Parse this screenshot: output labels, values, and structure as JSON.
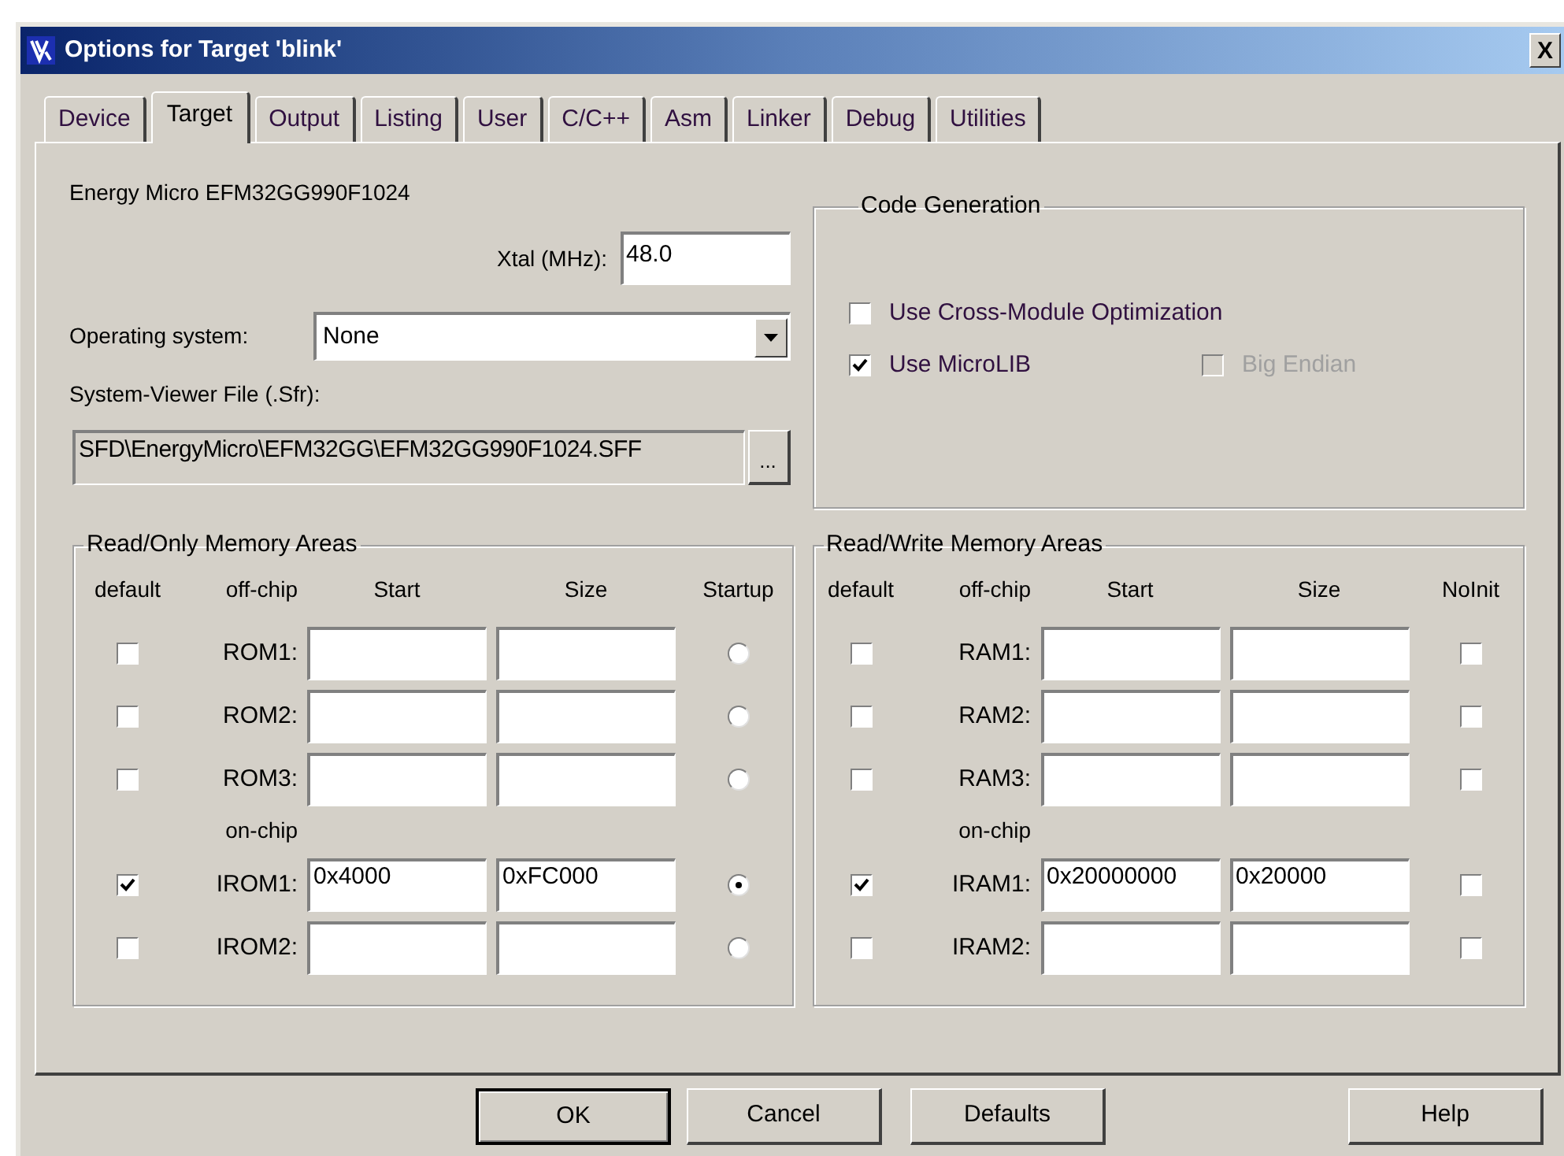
{
  "window": {
    "title": "Options for Target 'blink'",
    "close_button": "X"
  },
  "tabs": [
    {
      "label": "Device",
      "selected": false
    },
    {
      "label": "Target",
      "selected": true
    },
    {
      "label": "Output",
      "selected": false
    },
    {
      "label": "Listing",
      "selected": false
    },
    {
      "label": "User",
      "selected": false
    },
    {
      "label": "C/C++",
      "selected": false
    },
    {
      "label": "Asm",
      "selected": false
    },
    {
      "label": "Linker",
      "selected": false
    },
    {
      "label": "Debug",
      "selected": false
    },
    {
      "label": "Utilities",
      "selected": false
    }
  ],
  "device": "Energy Micro EFM32GG990F1024",
  "xtal": {
    "label": "Xtal (MHz):",
    "value": "48.0"
  },
  "operating_system": {
    "label": "Operating system:",
    "value": "None"
  },
  "system_viewer_file": {
    "label": "System-Viewer File (.Sfr):",
    "value": "SFD\\EnergyMicro\\EFM32GG\\EFM32GG990F1024.SFF",
    "browse_button": "..."
  },
  "code_generation": {
    "title": "Code Generation",
    "options": [
      {
        "label": "Use Cross-Module Optimization",
        "checked": false,
        "disabled": false
      },
      {
        "label": "Use MicroLIB",
        "checked": true,
        "disabled": false
      },
      {
        "label": "Big Endian",
        "checked": false,
        "disabled": true
      }
    ]
  },
  "memory_areas": [
    {
      "title": "Read/Only Memory Areas",
      "columns": [
        "default",
        "off-chip",
        "Start",
        "Size",
        "Startup"
      ],
      "rows": [
        {
          "kind": "entry",
          "default_checked": false,
          "label": "ROM1:",
          "startup_selected": false
        },
        {
          "kind": "entry",
          "default_checked": false,
          "label": "ROM2:",
          "startup_selected": false
        },
        {
          "kind": "entry",
          "default_checked": false,
          "label": "ROM3:",
          "startup_selected": false
        },
        {
          "kind": "section",
          "label": "on-chip"
        },
        {
          "kind": "entry",
          "default_checked": true,
          "label": "IROM1:",
          "start": "0x4000",
          "size": "0xFC000",
          "startup_selected": true
        },
        {
          "kind": "entry",
          "default_checked": false,
          "label": "IROM2:",
          "startup_selected": false
        }
      ]
    },
    {
      "title": "Read/Write Memory Areas",
      "columns": [
        "default",
        "off-chip",
        "Start",
        "Size",
        "NoInit"
      ],
      "rows": [
        {
          "kind": "entry",
          "default_checked": false,
          "label": "RAM1:",
          "noinit_checked": false
        },
        {
          "kind": "entry",
          "default_checked": false,
          "label": "RAM2:",
          "noinit_checked": false
        },
        {
          "kind": "entry",
          "default_checked": false,
          "label": "RAM3:",
          "noinit_checked": false
        },
        {
          "kind": "section",
          "label": "on-chip"
        },
        {
          "kind": "entry",
          "default_checked": true,
          "label": "IRAM1:",
          "start": "0x20000000",
          "size": "0x20000",
          "noinit_checked": false
        },
        {
          "kind": "entry",
          "default_checked": false,
          "label": "IRAM2:",
          "noinit_checked": false
        }
      ]
    }
  ],
  "buttons": [
    {
      "label": "OK",
      "default": true
    },
    {
      "label": "Cancel",
      "default": false
    },
    {
      "label": "Defaults",
      "default": false
    },
    {
      "label": "Help",
      "default": false
    }
  ]
}
